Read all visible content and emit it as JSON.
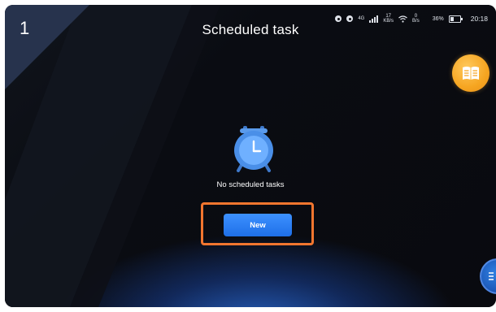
{
  "step": {
    "number": "1"
  },
  "header": {
    "title": "Scheduled task"
  },
  "status_bar": {
    "network": "4G",
    "down_speed": "17",
    "down_unit": "KB/s",
    "up_speed": "0",
    "up_unit": "B/s",
    "battery": "36%",
    "time": "20:18"
  },
  "main": {
    "empty_message": "No scheduled tasks",
    "new_button_label": "New",
    "clock_icon": "alarm-clock-icon"
  },
  "side_buttons": {
    "manual_icon": "book-icon",
    "menu_icon": "menu-icon"
  },
  "colors": {
    "accent_blue": "#1e6fe8",
    "highlight_orange": "#f2762f",
    "book_orange": "#f6a521",
    "clock_blue": "#4a8fe8"
  }
}
